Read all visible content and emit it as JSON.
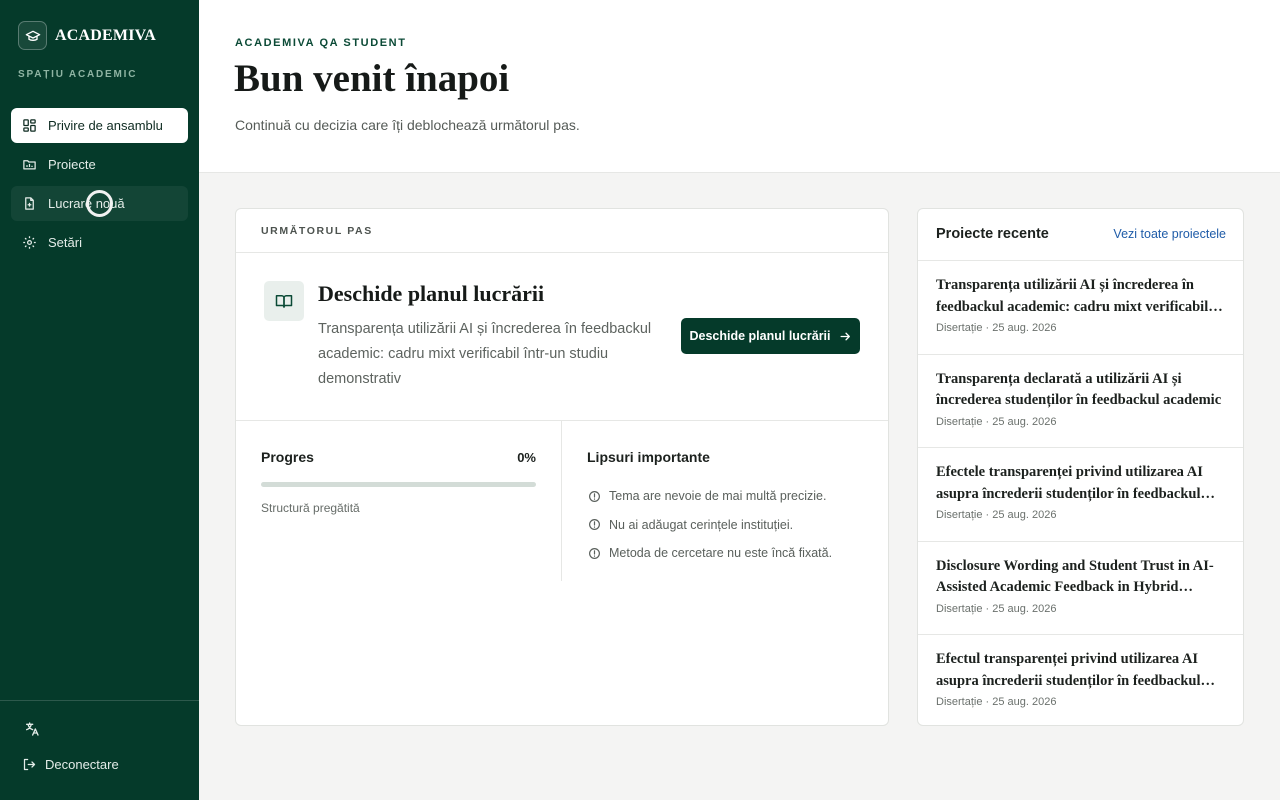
{
  "app": {
    "brand_name": "ACADEMIVA",
    "section_label": "SPAȚIU ACADEMIC"
  },
  "sidebar": {
    "items": [
      {
        "label": "Privire de ansamblu",
        "icon": "grid-icon",
        "active": true
      },
      {
        "label": "Proiecte",
        "icon": "folder-icon",
        "active": false
      },
      {
        "label": "Lucrare nouă",
        "icon": "file-plus-icon",
        "active": false,
        "hovered": true
      },
      {
        "label": "Setări",
        "icon": "gear-icon",
        "active": false
      }
    ],
    "language_icon": "translate-icon",
    "logout_label": "Deconectare"
  },
  "header": {
    "eyebrow": "ACADEMIVA QA STUDENT",
    "title": "Bun venit înapoi",
    "subtitle": "Continuă cu decizia care îți deblochează următorul pas."
  },
  "next_step": {
    "section_label": "URMĂTORUL PAS",
    "title": "Deschide planul lucrării",
    "description": "Transparența utilizării AI și încrederea în feedbackul academic: cadru mixt verificabil într-un studiu demonstrativ",
    "button_label": "Deschide planul lucrării",
    "progress": {
      "label": "Progres",
      "value_text": "0%",
      "value": 0,
      "caption": "Structură pregătită"
    },
    "gaps": {
      "title": "Lipsuri importante",
      "items": [
        "Tema are nevoie de mai multă precizie.",
        "Nu ai adăugat cerințele instituției.",
        "Metoda de cercetare nu este încă fixată."
      ]
    }
  },
  "recent": {
    "title": "Proiecte recente",
    "link_label": "Vezi toate proiectele",
    "items": [
      {
        "title": "Transparența utilizării AI și încrederea în feedbackul academic: cadru mixt verificabil într-un studiu demonstrativ",
        "meta": "Disertație · 25 aug. 2026"
      },
      {
        "title": "Transparența declarată a utilizării AI și încrederea studenților în feedbackul academic",
        "meta": "Disertație · 25 aug. 2026"
      },
      {
        "title": "Efectele transparenței privind utilizarea AI asupra încrederii studenților în feedbackul academic",
        "meta": "Disertație · 25 aug. 2026"
      },
      {
        "title": "Disclosure Wording and Student Trust in AI-Assisted Academic Feedback in Hybrid Settings",
        "meta": "Disertație · 25 aug. 2026"
      },
      {
        "title": "Efectul transparenței privind utilizarea AI asupra încrederii studenților în feedbackul academic",
        "meta": "Disertație · 25 aug. 2026"
      }
    ]
  },
  "colors": {
    "sidebar_bg": "#053a2a",
    "accent": "#053a2a",
    "link": "#1f5ca8"
  }
}
